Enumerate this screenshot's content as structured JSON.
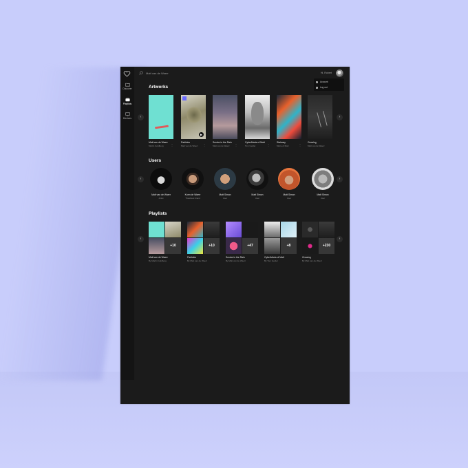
{
  "colors": {
    "background": "#c8cdfb",
    "device": "#1b1b1b",
    "sidebar": "#141414",
    "text_primary": "#ffffff",
    "text_secondary": "#8c8c8c"
  },
  "sidebar": {
    "items": [
      {
        "label": "Discover",
        "icon": "folder-icon"
      },
      {
        "label": "Playlists",
        "icon": "playlist-icon"
      },
      {
        "label": "Devices",
        "icon": "monitor-icon"
      }
    ]
  },
  "topbar": {
    "search_value": "Matt van de Waerr",
    "user_name": "Hi, Robert"
  },
  "dropdown": {
    "items": [
      "Account",
      "Log out"
    ]
  },
  "sections": {
    "artworks": "Artworks",
    "users": "Users",
    "playlists": "Playlists"
  },
  "artworks": [
    {
      "title": "Matt van de Waerr",
      "sub": "Martin Goldberg"
    },
    {
      "title": "Particles",
      "sub": "Matt van de Waerr"
    },
    {
      "title": "Smoke in the Rain",
      "sub": "Matt van de Waerr"
    },
    {
      "title": "CyberMaria of Malt",
      "sub": "Tom Geidel"
    },
    {
      "title": "Stairway",
      "sub": "Marie of Malt"
    },
    {
      "title": "Growing",
      "sub": "Matt van de Waerr"
    }
  ],
  "users": [
    {
      "name": "Matt van de Waerr",
      "role": "Artist"
    },
    {
      "name": "Koen de Waerr",
      "role": "Thewheel brand"
    },
    {
      "name": "Matt Simon",
      "role": "User"
    },
    {
      "name": "Matt Simon",
      "role": "User"
    },
    {
      "name": "Matt Simon",
      "role": "User"
    },
    {
      "name": "Matt Simon",
      "role": "User"
    }
  ],
  "playlists": [
    {
      "title": "Matt van de Waerr",
      "sub": "By Martin Goldberg",
      "count": "+10"
    },
    {
      "title": "Particles",
      "sub": "By Matt van de Waerr",
      "count": "+10"
    },
    {
      "title": "Smoke in the Rain",
      "sub": "By Matt van de Waerr",
      "count": "+47"
    },
    {
      "title": "CyberMaria of Malt",
      "sub": "By Tom Geidel",
      "count": "+8"
    },
    {
      "title": "Growing",
      "sub": "By Matt van de Waerr",
      "count": "+230"
    }
  ]
}
